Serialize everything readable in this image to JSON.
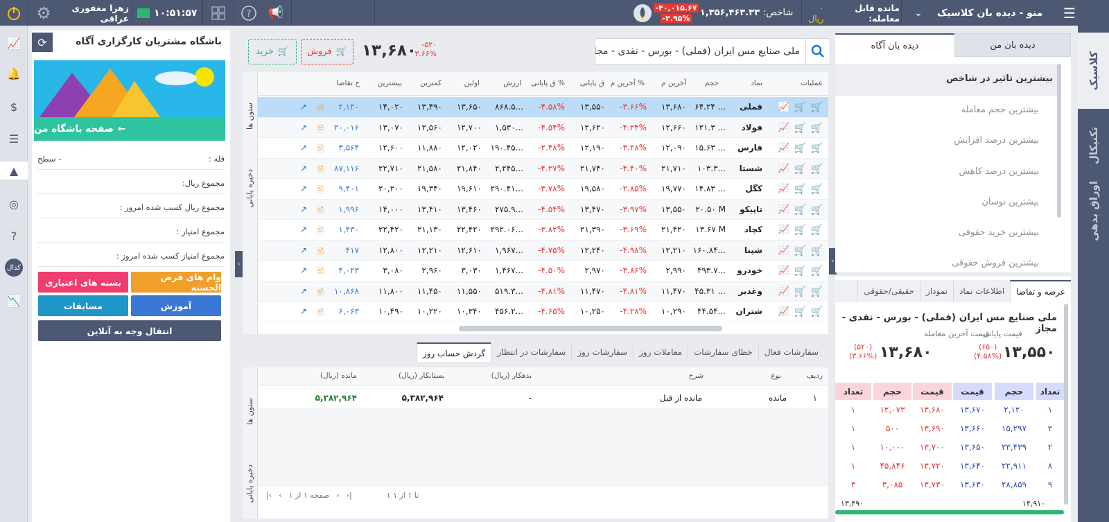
{
  "topbar": {
    "menu_title": "منو - دیده بان کلاسیک",
    "tradable_label": "مانده قابل معامله:",
    "tradable_value": "۰ ریال",
    "index_label": "شاخص:",
    "index_value": "۱,۳۵۶,۴۶۳.۳۳",
    "index_change": "-۴۰,۰۱۵.۶۷",
    "index_change_pct": "-۲.۹۵%",
    "time": "۱۰:۵۱:۵۷",
    "user_name": "زهرا مغفوری عراقی",
    "colors": {
      "bar": "#4d5973",
      "negative": "#e53935",
      "accent": "#f5c400"
    }
  },
  "right_rail": {
    "tabs": [
      "کلاسیک",
      "تکنیکال",
      "اوراق بدهی"
    ]
  },
  "watch": {
    "tabs": [
      "دیده بان من",
      "دیده بان آگاه"
    ],
    "active_tab": "دیده بان آگاه",
    "items": [
      "بیشترین تاثیر در شاخص",
      "بیشترین حجم معامله",
      "بیشترین درصد افزایش",
      "بیشترین درصد کاهش",
      "بیشترین نوسان",
      "بیشترین خرید حقوقی",
      "بیشترین فروش حقوقی"
    ]
  },
  "orderbook": {
    "tabs": [
      "عرضه و تقاضا",
      "اطلاعات نماد",
      "نمودار",
      "حقیقی/حقوقی"
    ],
    "symbol_title": "ملی صنایع مس ایران (فملی) - بورس - نقدی - مجاز",
    "last_price_label": "قیمت آخرین معامله",
    "last_price": "۱۳,۶۸۰",
    "last_change": "(۵۲۰)",
    "last_change_pct": "(۳.۶۶%)",
    "close_price_label": "قیمت پایانی",
    "close_price": "۱۳,۵۵۰",
    "close_change": "(۶۵۰)",
    "close_change_pct": "(۴.۵۸%)",
    "headers": [
      "تعداد",
      "حجم",
      "قیمت",
      "قیمت",
      "حجم",
      "تعداد"
    ],
    "rows": [
      [
        "۱",
        "۲,۱۲۰",
        "۱۳,۶۷۰",
        "۱۳,۶۸۰",
        "۱۲,۰۷۳",
        "۱"
      ],
      [
        "۲",
        "۱۵,۲۹۷",
        "۱۳,۶۶۰",
        "۱۳,۶۹۰",
        "۵۰۰",
        "۱"
      ],
      [
        "۲",
        "۲۳,۴۳۹",
        "۱۳,۶۵۰",
        "۱۳,۷۰۰",
        "۱۰,۰۰۰",
        "۱"
      ],
      [
        "۸",
        "۲۲,۹۱۱",
        "۱۳,۶۴۰",
        "۱۳,۷۲۰",
        "۴۵,۸۴۶",
        "۱"
      ],
      [
        "۹",
        "۲۸,۸۵۹",
        "۱۳,۶۳۰",
        "۱۳,۷۳۰",
        "۳,۰۸۵",
        "۳"
      ]
    ],
    "range_low": "۱۳,۴۹۰",
    "range_high": "۱۴,۹۱۰"
  },
  "symbolbar": {
    "search_value": "ملی صنایع مس ایران (فملی) - بورس - نقدی - مجاز",
    "price": "۱۳,۶۸۰",
    "change": "-۵۲۰",
    "change_pct": "۳.۶۶%",
    "sell_label": "فروش",
    "buy_label": "خرید"
  },
  "market": {
    "headers": [
      "عملیات",
      "نماد",
      "حجم",
      "آخرین م",
      "% آخرین م",
      "ق پایانی",
      "% ق پایانی",
      "ارزش",
      "اولین",
      "کمترین",
      "بیشترین",
      "ح تقاضا"
    ],
    "side_tabs": [
      "ستون ها",
      "ذخیره پایانی"
    ],
    "rows": [
      {
        "sym": "فملی",
        "vol": "۶۴.۲۴ ...",
        "last": "۱۳,۶۸۰",
        "lastp": "-۳.۶۶%",
        "close": "۱۳,۵۵۰",
        "closep": "-۴.۵۸%",
        "val": "۸۶۸.۵...",
        "first": "۱۳,۶۵۰",
        "low": "۱۳,۴۹۰",
        "high": "۱۴,۰۲۰",
        "bid": "۲,۱۲۰"
      },
      {
        "sym": "فولاد",
        "vol": "۱۲۱.۳ ...",
        "last": "۱۲,۶۶۰",
        "lastp": "-۴.۲۴%",
        "close": "۱۲,۶۲۰",
        "closep": "-۴.۵۴%",
        "val": "۱,۵۳۰...",
        "first": "۱۲,۷۰۰",
        "low": "۱۲,۵۶۰",
        "high": "۱۳,۰۷۰",
        "bid": "۲۰,۰۱۶"
      },
      {
        "sym": "فارس",
        "vol": "۱۵.۶۳ ...",
        "last": "۱۲,۰۹۰",
        "lastp": "-۳.۲۸%",
        "close": "۱۲,۱۹۰",
        "closep": "-۲.۴۸%",
        "val": "۱۹۰.۴۵...",
        "first": "۱۲,۰۲۰",
        "low": "۱۱,۸۸۰",
        "high": "۱۲,۶۰۰",
        "bid": "۳,۵۶۴"
      },
      {
        "sym": "شستا",
        "vol": "۱۰۳.۳...",
        "last": "۲۱,۷۱۰",
        "lastp": "-۴.۴۰%",
        "close": "۲۱,۷۴۰",
        "closep": "-۴.۲۷%",
        "val": "۲,۲۴۵...",
        "first": "۲۱,۸۴۰",
        "low": "۲۱,۵۸۰",
        "high": "۲۲,۷۱۰",
        "bid": "۸۷,۱۱۶"
      },
      {
        "sym": "کگل",
        "vol": "۱۴.۸۳ ...",
        "last": "۱۹,۷۷۰",
        "lastp": "-۲.۸۵%",
        "close": "۱۹,۵۸۰",
        "closep": "-۳.۷۸%",
        "val": "۲۹۰.۴۱...",
        "first": "۱۹,۶۱۰",
        "low": "۱۹,۳۴۰",
        "high": "۲۰,۲۰۰",
        "bid": "۹,۴۰۱"
      },
      {
        "sym": "تاپیکو",
        "vol": "۲۰.۵۰ M",
        "last": "۱۳,۵۵۰",
        "lastp": "-۳.۹۷%",
        "close": "۱۳,۴۷۰",
        "closep": "-۴.۵۴%",
        "val": "۲۷۵.۹...",
        "first": "۱۳,۴۶۰",
        "low": "۱۳,۴۱۰",
        "high": "۱۴,۰۰۰",
        "bid": "۱,۹۹۶"
      },
      {
        "sym": "کچاد",
        "vol": "۱۳.۶۷ M",
        "last": "۲۱,۴۲۰",
        "lastp": "-۳.۶۹%",
        "close": "۲۱,۳۹۰",
        "closep": "-۳.۸۲%",
        "val": "۲۹۲.۰۶...",
        "first": "۲۲,۴۲۰",
        "low": "۲۱,۱۳۰",
        "high": "۲۲,۴۲۰",
        "bid": "۱,۴۳۰"
      },
      {
        "sym": "شپنا",
        "vol": "۱۶۰.۸۴...",
        "last": "۱۲,۲۱۰",
        "lastp": "-۴.۹۸%",
        "close": "۱۲,۲۴۰",
        "closep": "-۴.۷۵%",
        "val": "۱,۹۶۷...",
        "first": "۱۲,۶۱۰",
        "low": "۱۲,۲۱۰",
        "high": "۱۲,۸۰۰",
        "bid": "۴۱۷"
      },
      {
        "sym": "خودرو",
        "vol": "۴۹۳.۷...",
        "last": "۲,۹۹۰",
        "lastp": "-۳.۸۶%",
        "close": "۲,۹۷۰",
        "closep": "-۴.۵۰%",
        "val": "۱,۴۶۷...",
        "first": "۳,۰۳۰",
        "low": "۲,۹۶۰",
        "high": "۳,۰۸۰",
        "bid": "۴,۰۲۳"
      },
      {
        "sym": "وغدیر",
        "vol": "۴۵.۳۱ ...",
        "last": "۱۱,۴۷۰",
        "lastp": "-۴.۸۱%",
        "close": "۱۱,۴۷۰",
        "closep": "-۴.۸۱%",
        "val": "۵۱۹.۳...",
        "first": "۱۱,۵۵۰",
        "low": "۱۱,۴۵۰",
        "high": "۱۱,۸۰۰",
        "bid": "۱۰,۸۶۸"
      },
      {
        "sym": "شتران",
        "vol": "۴۴.۵۴...",
        "last": "۱۰,۲۹۰",
        "lastp": "-۴.۲۸%",
        "close": "۱۰,۲۵۰",
        "closep": "-۴.۶۵%",
        "val": "۴۵۶.۲...",
        "first": "۱۰,۳۴۰",
        "low": "۱۰,۲۲۰",
        "high": "۱۰,۴۹۰",
        "bid": "۶,۰۶۳"
      }
    ]
  },
  "orders": {
    "tabs": [
      "سفارشات فعال",
      "خطای سفارشات",
      "معاملات روز",
      "سفارشات روز",
      "سفارشات در انتظار",
      "گردش حساب روز"
    ],
    "active_tab": "گردش حساب روز",
    "headers": [
      "ردیف",
      "نوع",
      "شرح",
      "بدهکار (ریال)",
      "بستانکار (ریال)",
      "مانده (ریال)"
    ],
    "rows": [
      [
        "۱",
        "مانده",
        "مانده از قبل",
        "-",
        "۵,۳۸۲,۹۶۴",
        "۵,۳۸۲,۹۶۴"
      ]
    ],
    "pager_range": "۱ تا ۱ از ۱",
    "pager_page": "صفحه ۱ از ۱"
  },
  "club": {
    "title": "باشگاه مشتریان کارگزاری آگاه",
    "banner_text": "صفحه باشگاه من",
    "level_label": "قله :",
    "level_value": "- سطح",
    "fields": [
      "مجموع ریال:",
      "مجموع ریال کسب شده امروز :",
      "مجموع امتیاز :",
      "مجموع امتیاز کسب شده امروز :"
    ],
    "btn_loan": "وام های قرض الحسنه",
    "btn_credit": "بسته های اعتباری",
    "btn_edu": "آموزش",
    "btn_contest": "مسابقات",
    "btn_transfer": "انتقال وجه به آنلاین"
  }
}
